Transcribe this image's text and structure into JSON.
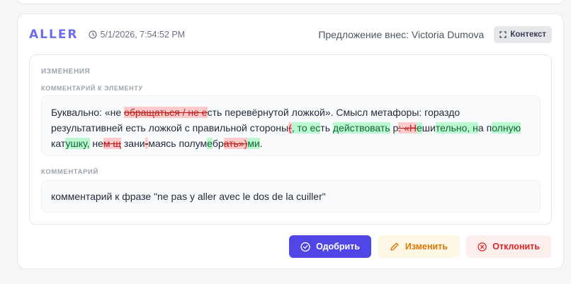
{
  "card": {
    "word": "ALLER",
    "timestamp": "5/1/2026, 7:54:52 PM",
    "proposer": "Предложение внес: Victoria Dumova",
    "context_label": "Контекст"
  },
  "changes": {
    "section_title": "ИЗМЕНЕНИЯ",
    "field_title": "КОММЕНТАРИЙ К ЭЛЕМЕНТУ",
    "diff_segments": [
      {
        "t": "Буквально: «не ",
        "k": "eq"
      },
      {
        "t": "обращаться / не ",
        "k": "del"
      },
      {
        "t": "е",
        "k": "del"
      },
      {
        "t": "сть перевёрнутой ложкой». Смысл метафоры: гораздо результативней есть ложкой с правильной стороны",
        "k": "eq"
      },
      {
        "t": "(",
        "k": "del"
      },
      {
        "t": ", то ес",
        "k": "ins"
      },
      {
        "t": "ть ",
        "k": "eq"
      },
      {
        "t": "действовать",
        "k": "ins"
      },
      {
        "t": " р",
        "k": "eq"
      },
      {
        "t": ": «Н",
        "k": "del"
      },
      {
        "t": "е",
        "k": "ins"
      },
      {
        "t": "ши",
        "k": "eq"
      },
      {
        "t": "те",
        "k": "ins"
      },
      {
        "t": "льно, н",
        "k": "ins"
      },
      {
        "t": "а п",
        "k": "eq"
      },
      {
        "t": "олную ",
        "k": "ins"
      },
      {
        "t": "кат",
        "k": "eq"
      },
      {
        "t": "ушку,",
        "k": "ins"
      },
      {
        "t": " не",
        "k": "eq"
      },
      {
        "t": "м щ",
        "k": "del"
      },
      {
        "t": " зани",
        "k": "eq"
      },
      {
        "t": "-",
        "k": "del"
      },
      {
        "t": "маясь полум",
        "k": "eq"
      },
      {
        "t": "е",
        "k": "ins"
      },
      {
        "t": "бр",
        "k": "eq"
      },
      {
        "t": "ать»)",
        "k": "del"
      },
      {
        "t": "ми",
        "k": "ins"
      },
      {
        "t": ".",
        "k": "eq"
      }
    ],
    "comment_title": "КОММЕНТАРИЙ",
    "comment_text": "комментарий к фразе \"ne pas y aller avec le dos de la cuiller\""
  },
  "actions": {
    "approve_label": "Одобрить",
    "edit_label": "Изменить",
    "reject_label": "Отклонить"
  },
  "colors": {
    "accent": "#5046e5",
    "word_title": "#6d6cf0",
    "deleted_bg": "#fecaca",
    "inserted_bg": "#bbf7d0"
  }
}
